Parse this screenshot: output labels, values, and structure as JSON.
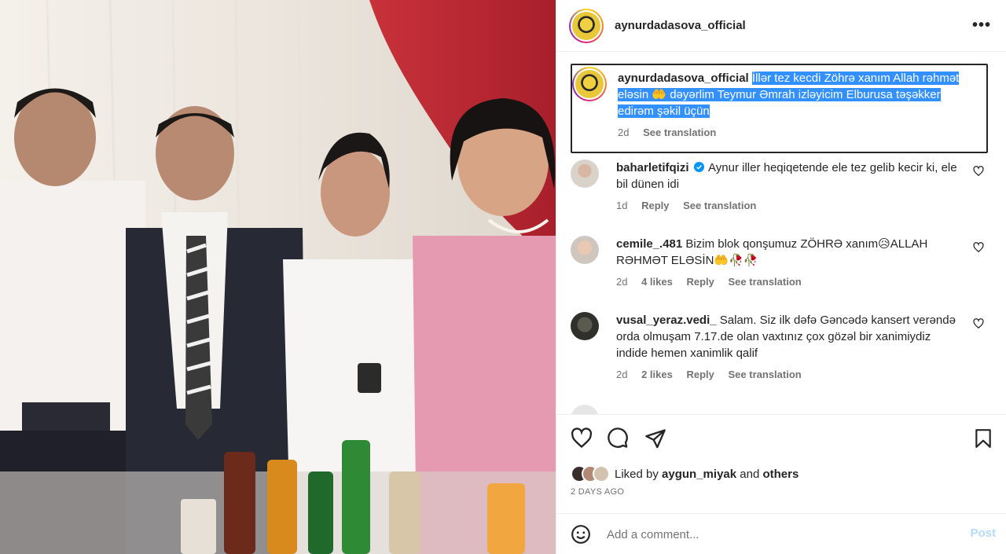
{
  "post": {
    "username": "aynurdadasova_official",
    "more_label": "•••"
  },
  "caption": {
    "username": "aynurdadasova_official",
    "text_line1": "İllər tez kecdi Zöhrə xanım Allah rəhmət",
    "text_line2": "eləsin 🤲 dəyərlim Teymur Əmrah izləyicim Elburusa təşəkker",
    "text_line3": "edirəm şəkil üçün",
    "time": "2d",
    "see_translation": "See translation"
  },
  "comments": [
    {
      "username": "baharletifqizi",
      "verified": true,
      "text": "Aynur iller heqiqetende ele tez gelib kecir ki, ele bil dünen idi",
      "time": "1d",
      "likes": "",
      "reply": "Reply",
      "see_translation": "See translation"
    },
    {
      "username": "cemile_.481",
      "verified": false,
      "text": "Bizim blok qonşumuz ZÖHRƏ xanım😥ALLAH RƏHMƏT ELƏSİN🤲🥀🥀",
      "time": "2d",
      "likes": "4 likes",
      "reply": "Reply",
      "see_translation": "See translation"
    },
    {
      "username": "vusal_yeraz.vedi_",
      "verified": false,
      "text": "Salam. Siz ilk dəfə Gəncədə kansert verəndə orda olmuşam 7.17.de olan vaxtınız çox gözəl bir xanimiydiz indide hemen xanimlik qalif",
      "time": "2d",
      "likes": "2 likes",
      "reply": "Reply",
      "see_translation": "See translation"
    }
  ],
  "likes": {
    "prefix": "Liked by",
    "user": "aygun_miyak",
    "and": "and",
    "others": "others"
  },
  "posted_ago": "2 DAYS AGO",
  "add_comment": {
    "placeholder": "Add a comment...",
    "post_label": "Post"
  },
  "icons": {
    "like": "heart-icon",
    "comment": "comment-icon",
    "share": "share-icon",
    "save": "bookmark-icon",
    "emoji": "emoji-icon",
    "more": "more-icon"
  },
  "colors": {
    "highlight": "#3390ff",
    "verified": "#0095f6",
    "post_disabled": "#b3dbff",
    "muted": "#737373"
  }
}
